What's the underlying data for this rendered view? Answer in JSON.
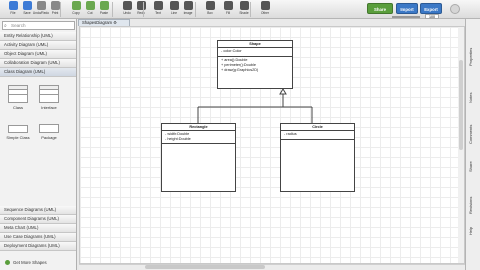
{
  "toolbar": {
    "tools": [
      {
        "label": "File",
        "icon": "file-icon",
        "color": "#3d7bd6"
      },
      {
        "label": "Save",
        "icon": "save-icon",
        "color": "#3d7bd6"
      },
      {
        "label": "Undo/Redo",
        "icon": "undo-icon",
        "color": "#888888"
      },
      {
        "label": "Print",
        "icon": "print-icon",
        "color": "#888888"
      },
      {
        "label": "Copy",
        "icon": "copy-icon",
        "color": "#6aa84f"
      },
      {
        "label": "Cut",
        "icon": "cut-icon",
        "color": "#6aa84f"
      },
      {
        "label": "Paste",
        "icon": "paste-icon",
        "color": "#6aa84f"
      },
      {
        "label": "Undo",
        "icon": "undo-arrow-icon",
        "color": "#555555"
      },
      {
        "label": "Redo",
        "icon": "redo-arrow-icon",
        "color": "#555555"
      },
      {
        "label": "Text",
        "icon": "text-icon",
        "color": "#555555"
      },
      {
        "label": "Line",
        "icon": "line-icon",
        "color": "#555555"
      },
      {
        "label": "Image",
        "icon": "image-icon",
        "color": "#555555"
      },
      {
        "label": "Box",
        "icon": "box-icon",
        "color": "#555555"
      },
      {
        "label": "Fill",
        "icon": "fill-icon",
        "color": "#555555"
      },
      {
        "label": "Shade",
        "icon": "shade-icon",
        "color": "#555555"
      },
      {
        "label": "Other",
        "icon": "other-icon",
        "color": "#555555"
      }
    ],
    "share_label": "Share",
    "import_label": "Import",
    "export_label": "Export",
    "zoom_label": "100",
    "zoom_value": "100"
  },
  "sidebar": {
    "search_placeholder": "Search",
    "categories_top": [
      "Entity Relationship (UML)",
      "Activity Diagram (UML)",
      "Object Diagram (UML)",
      "Collaboration Diagram (UML)",
      "Class Diagram (UML)"
    ],
    "open_category": "Class Diagram (UML)",
    "tiles": [
      {
        "label": "Class"
      },
      {
        "label": "Interface"
      },
      {
        "label": "Simple Class"
      },
      {
        "label": "Package"
      }
    ],
    "categories_bottom": [
      "Sequence Diagrams (UML)",
      "Component Diagrams (UML)",
      "Meta Chart (UML)",
      "Use Case Diagrams (UML)",
      "Deployment Diagrams (UML)"
    ],
    "get_more": "Get More Shapes"
  },
  "tab": {
    "label": "ShapesDiagram"
  },
  "diagram": {
    "shape": {
      "name": "Shape",
      "attrs": [
        "- color:Color"
      ],
      "ops": [
        "+ area():Double",
        "+ perimeter():Double",
        "+ draw(g:Graphics2D)"
      ]
    },
    "rectangle": {
      "name": "Rectangle",
      "attrs": [
        "- width:Double",
        "- height:Double"
      ],
      "ops": []
    },
    "circle": {
      "name": "Circle",
      "attrs": [
        "- radius"
      ],
      "ops": []
    }
  },
  "rightbar": {
    "tabs": [
      "Properties",
      "Notes",
      "Comments",
      "Share",
      "Revisions",
      "Help"
    ]
  }
}
